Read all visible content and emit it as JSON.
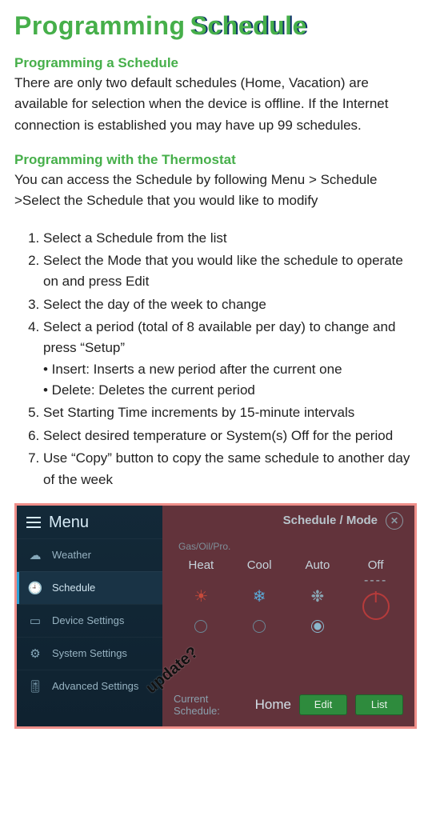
{
  "title_word1": "Programming",
  "title_word2": "Schedule",
  "section1_head": "Programming a Schedule",
  "section1_body": "There are only two default schedules (Home, Vacation) are available for selection when the device is offline. If the Internet connection is established you may have up 99 schedules.",
  "section2_head": "Programming with the Thermostat",
  "section2_body": "You can access the Schedule by following Menu > Schedule >Select the Schedule that you would like to modify",
  "steps": [
    "Select a Schedule from the list",
    "Select the Mode that you would like the schedule to operate on and press Edit",
    "Select the day of the week to change",
    "Select a period (total of 8 available per day) to change and press “Setup”",
    "Set Starting Time increments by 15-minute intervals",
    "Select desired temperature or System(s) Off for the period",
    "Use “Copy” button to copy the same schedule to another day of the week"
  ],
  "step4_sub": [
    "• Insert: Inserts a new period after the current one",
    "• Delete: Deletes the current period"
  ],
  "shot": {
    "menu_title": "Menu",
    "side_items": [
      "Weather",
      "Schedule",
      "Device Settings",
      "System Settings",
      "Advanced Settings"
    ],
    "panel_title": "Schedule / Mode",
    "hint": "Gas/Oil/Pro.",
    "modes": [
      "Heat",
      "Cool",
      "Auto",
      "Off"
    ],
    "off_dashes": "----",
    "current_label": "Current Schedule:",
    "current_value": "Home",
    "btn_edit": "Edit",
    "btn_list": "List",
    "annotation": "update?"
  }
}
